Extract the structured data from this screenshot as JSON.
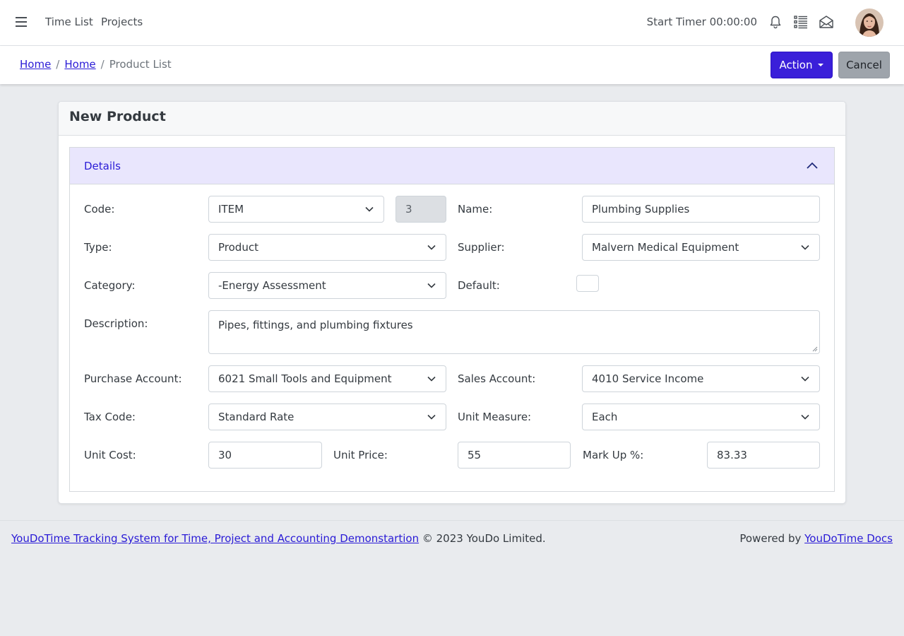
{
  "topbar": {
    "nav_items": [
      "Time List",
      "Projects"
    ],
    "timer_text": "Start Timer 00:00:00",
    "icons": [
      "bell-icon",
      "list-icon",
      "envelope-icon"
    ]
  },
  "breadcrumb": {
    "items": [
      "Home",
      "Home",
      "Product List"
    ]
  },
  "actions": {
    "action_label": "Action",
    "cancel_label": "Cancel"
  },
  "form": {
    "title": "New Product",
    "section_title": "Details",
    "code": {
      "label": "Code:",
      "value": "ITEM",
      "number": "3"
    },
    "name": {
      "label": "Name:",
      "value": "Plumbing Supplies"
    },
    "type": {
      "label": "Type:",
      "value": "Product"
    },
    "supplier": {
      "label": "Supplier:",
      "value": "Malvern Medical Equipment"
    },
    "category": {
      "label": "Category:",
      "value": "-Energy Assessment"
    },
    "default": {
      "label": "Default:",
      "checked": false
    },
    "description": {
      "label": "Description:",
      "value": "Pipes, fittings, and plumbing fixtures"
    },
    "purchase_account": {
      "label": "Purchase Account:",
      "value": "6021 Small Tools and Equipment"
    },
    "sales_account": {
      "label": "Sales Account:",
      "value": "4010 Service Income"
    },
    "tax_code": {
      "label": "Tax Code:",
      "value": "Standard Rate"
    },
    "unit_measure": {
      "label": "Unit Measure:",
      "value": "Each"
    },
    "unit_cost": {
      "label": "Unit Cost:",
      "value": "30"
    },
    "unit_price": {
      "label": "Unit Price:",
      "value": "55"
    },
    "mark_up": {
      "label": "Mark Up %:",
      "value": "83.33"
    }
  },
  "footer": {
    "app_link": "YouDoTime Tracking System for Time, Project and Accounting Demonstartion",
    "copyright": "© 2023 YouDo Limited.",
    "powered_by": "Powered by",
    "docs_link": "YouDoTime Docs"
  },
  "colors": {
    "primary": "#3a1fd9",
    "link": "#2a1bd6",
    "section_header_bg": "#e9e6fd",
    "page_bg": "#e9ebee",
    "cancel_bg": "#9ea4ab"
  }
}
